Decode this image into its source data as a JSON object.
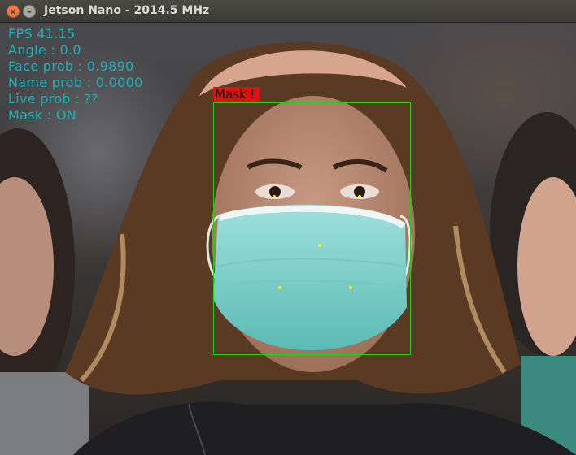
{
  "window": {
    "title": "Jetson Nano - 2014.5 MHz"
  },
  "overlay": {
    "fps": "FPS 41.15",
    "angle": "Angle : 0.0",
    "face_prob": "Face prob : 0.9890",
    "name_prob": "Name prob : 0.0000",
    "live_prob": "Live prob : ??",
    "mask": "Mask : ON"
  },
  "detection": {
    "label": "Mask !",
    "box_color": "#16d416",
    "label_color": "#e60f0f",
    "landmark_color": "#f5f500"
  },
  "colors": {
    "overlay_text": "#17b3b9",
    "titlebar": "#3c3b37",
    "close_button": "#f07746"
  }
}
